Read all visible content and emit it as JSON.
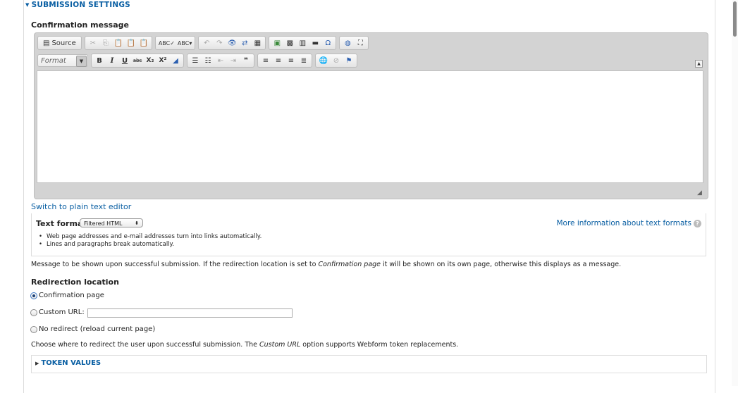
{
  "section": {
    "title": "SUBMISSION SETTINGS"
  },
  "confirmation": {
    "label": "Confirmation message",
    "editor": {
      "toolbar_row1": {
        "source_label": "Source",
        "icons": [
          "cut-icon",
          "copy-icon",
          "paste-icon",
          "paste-text-icon",
          "paste-word-icon",
          "spellcheck-icon",
          "spellcheck-as-you-type-icon",
          "undo-icon",
          "redo-icon",
          "find-icon",
          "replace-icon",
          "select-all-icon",
          "image-icon",
          "flash-icon",
          "table-icon",
          "horizontal-rule-icon",
          "special-char-icon",
          "iframe-icon",
          "maximize-icon"
        ]
      },
      "toolbar_row2": {
        "format_placeholder": "Format",
        "bold": "B",
        "italic": "I",
        "underline": "U",
        "strike": "abc",
        "subscript": "X₂",
        "superscript": "X²",
        "blockquote": "❞"
      }
    },
    "switch_link": "Switch to plain text editor"
  },
  "text_format": {
    "label": "Text format",
    "selected": "Filtered HTML",
    "more_info": "More information about text formats",
    "tips": [
      "Web page addresses and e-mail addresses turn into links automatically.",
      "Lines and paragraphs break automatically."
    ]
  },
  "message_help": {
    "before": "Message to be shown upon successful submission. If the redirection location is set to ",
    "emphasis": "Confirmation page",
    "after": " it will be shown on its own page, otherwise this displays as a message."
  },
  "redirection": {
    "label": "Redirection location",
    "options": [
      {
        "label": "Confirmation page",
        "checked": true
      },
      {
        "label": "Custom URL:",
        "checked": false
      },
      {
        "label": "No redirect (reload current page)",
        "checked": false
      }
    ],
    "custom_url_value": "",
    "help_before": "Choose where to redirect the user upon successful submission. The ",
    "help_emphasis": "Custom URL",
    "help_after": " option supports Webform token replacements."
  },
  "tokens": {
    "title": "TOKEN VALUES"
  }
}
